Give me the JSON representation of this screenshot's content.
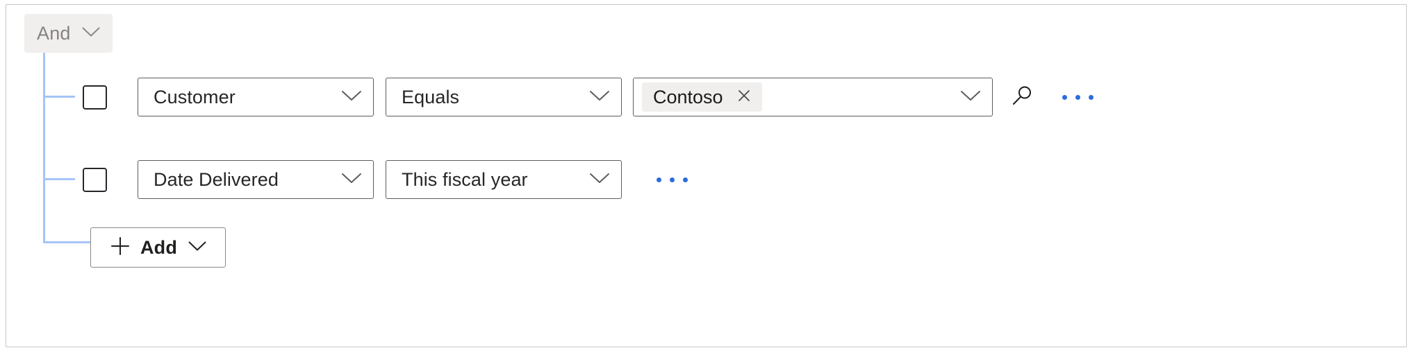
{
  "group": {
    "operator_label": "And",
    "operator_icon": "chevron-down-icon"
  },
  "conditions": [
    {
      "checkbox_name": "row-select-checkbox",
      "field": "Customer",
      "operator": "Equals",
      "value_pill": "Contoso",
      "pill_close_icon": "close-icon",
      "has_search": true,
      "search_icon": "search-icon",
      "overflow_icon": "more-options-icon"
    },
    {
      "checkbox_name": "row-select-checkbox",
      "field": "Date Delivered",
      "operator": "This fiscal year",
      "value_pill": null,
      "has_search": false,
      "overflow_icon": "more-options-icon"
    }
  ],
  "add_button": {
    "label": "Add",
    "plus_icon": "plus-icon",
    "chevron_icon": "chevron-down-icon"
  },
  "colors": {
    "tree_line": "#a5c4f7",
    "chip_background": "#f1efee",
    "overflow_dots": "#2a6ddb",
    "border": "#5c5c5c",
    "panel_border": "#c8c6c4"
  }
}
